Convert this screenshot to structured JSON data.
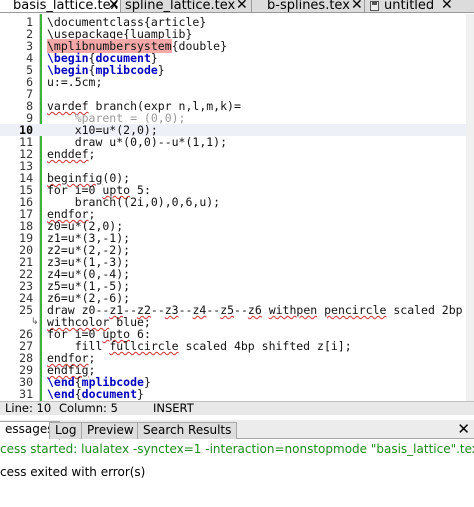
{
  "tabs": [
    {
      "label": "basis_lattice.tex",
      "active": true
    },
    {
      "label": "spline_lattice.tex",
      "active": false
    },
    {
      "label": "b-splines.tex",
      "active": false
    },
    {
      "label": "untitled",
      "active": false
    }
  ],
  "close_glyph": "✕",
  "editor": {
    "current_line": 10,
    "lines": [
      {
        "n": "1",
        "text": "\\documentclass{article}"
      },
      {
        "n": "2",
        "text": "\\usepackage{luamplib}"
      },
      {
        "n": "3",
        "text": "\\mplibnumbersystem{double}"
      },
      {
        "n": "4",
        "text": "\\begin{document}"
      },
      {
        "n": "5",
        "text": "\\begin{mplibcode}"
      },
      {
        "n": "6",
        "text": "u:=.5cm;"
      },
      {
        "n": "7",
        "text": ""
      },
      {
        "n": "8",
        "text": "vardef branch(expr n,l,m,k)="
      },
      {
        "n": "9",
        "text": "    %parent = (0,0);"
      },
      {
        "n": "10",
        "text": "    x10=u*(2,0);"
      },
      {
        "n": "11",
        "text": "    draw u*(0,0)--u*(1,1);"
      },
      {
        "n": "12",
        "text": "enddef;"
      },
      {
        "n": "13",
        "text": ""
      },
      {
        "n": "14",
        "text": "beginfig(0);"
      },
      {
        "n": "15",
        "text": "for i=0 upto 5:"
      },
      {
        "n": "16",
        "text": "    branch((2i,0),0,6,u);"
      },
      {
        "n": "17",
        "text": "endfor;"
      },
      {
        "n": "18",
        "text": "z0=u*(2,0);"
      },
      {
        "n": "19",
        "text": "z1=u*(3,-1);"
      },
      {
        "n": "20",
        "text": "z2=u*(2,-2);"
      },
      {
        "n": "21",
        "text": "z3=u*(1,-3);"
      },
      {
        "n": "22",
        "text": "z4=u*(0,-4);"
      },
      {
        "n": "23",
        "text": "z5=u*(1,-5);"
      },
      {
        "n": "24",
        "text": "z6=u*(2,-6);"
      },
      {
        "n": "25",
        "text": "draw z0--z1--z2--z3--z4--z5--z6 withpen pencircle scaled 2bp"
      },
      {
        "n": "",
        "text": "withcolor blue;"
      },
      {
        "n": "26",
        "text": "for i=0 upto 6:"
      },
      {
        "n": "27",
        "text": "    fill fullcircle scaled 4bp shifted z[i];"
      },
      {
        "n": "28",
        "text": "endfor;"
      },
      {
        "n": "29",
        "text": "endfig;"
      },
      {
        "n": "30",
        "text": "\\end{mplibcode}"
      },
      {
        "n": "31",
        "text": "\\end{document}"
      }
    ]
  },
  "status": {
    "line": "Line: 10",
    "column": "Column: 5",
    "mode": "INSERT"
  },
  "panel": {
    "tabs": [
      "essages",
      "Log",
      "Preview",
      "Search Results"
    ],
    "messages": [
      {
        "text": "cess started: lualatex -synctex=1 -interaction=nonstopmode \"basis_lattice\".tex",
        "color": "#1f8a1f"
      },
      {
        "text": "cess exited with error(s)",
        "color": "#000000"
      }
    ]
  }
}
